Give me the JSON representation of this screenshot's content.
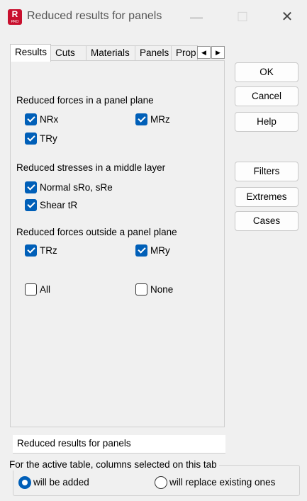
{
  "window": {
    "title": "Reduced results for panels",
    "icon_letter": "R",
    "icon_sub": "PRO",
    "icon_color": "#c8102e",
    "minimize": "—",
    "maximize": "☐",
    "close": "✕"
  },
  "tabs": [
    {
      "label": "Results",
      "active": true
    },
    {
      "label": "Cuts",
      "active": false
    },
    {
      "label": "Materials",
      "active": false
    },
    {
      "label": "Panels",
      "active": false
    },
    {
      "label": "Prop",
      "active": false
    }
  ],
  "tab_scroll": {
    "left": "◀",
    "right": "▶"
  },
  "groups": {
    "forces_in_plane": {
      "title": "Reduced forces in a panel plane",
      "items": [
        {
          "label": "NRx",
          "checked": true
        },
        {
          "label": "MRz",
          "checked": true
        },
        {
          "label": "TRy",
          "checked": true
        }
      ]
    },
    "stresses_middle": {
      "title": "Reduced stresses in a middle layer",
      "items": [
        {
          "label": "Normal sRo, sRe",
          "checked": true
        },
        {
          "label": "Shear tR",
          "checked": true
        }
      ]
    },
    "forces_outside": {
      "title": "Reduced forces outside a panel plane",
      "items": [
        {
          "label": "TRz",
          "checked": true
        },
        {
          "label": "MRy",
          "checked": true
        }
      ]
    }
  },
  "select_all": {
    "label": "All",
    "checked": false
  },
  "select_none": {
    "label": "None",
    "checked": false
  },
  "buttons": {
    "ok": "OK",
    "cancel": "Cancel",
    "help": "Help",
    "filters": "Filters",
    "extremes": "Extremes",
    "cases": "Cases"
  },
  "description": "Reduced results for panels",
  "columns_group": {
    "legend": "For the active table, columns selected on this tab",
    "options": [
      {
        "label": "will be added",
        "selected": true
      },
      {
        "label": "will replace existing ones",
        "selected": false
      }
    ]
  },
  "accent_color": "#005fb8"
}
